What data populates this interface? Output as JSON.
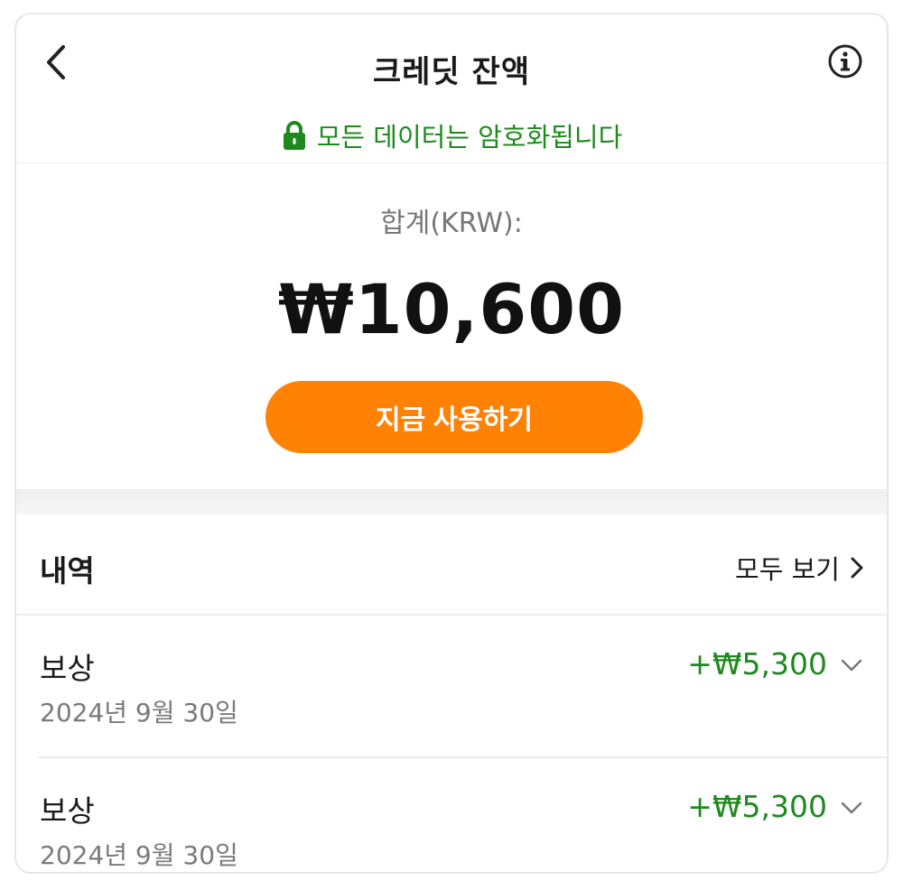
{
  "header": {
    "title": "크레딧 잔액",
    "back_icon": "chevron-left-icon",
    "info_icon": "info-icon"
  },
  "security": {
    "text": "모든 데이터는 암호화됩니다",
    "icon": "lock-icon",
    "color": "#1e8a1e"
  },
  "balance": {
    "label": "합계(KRW):",
    "amount": "₩10,600"
  },
  "action": {
    "use_now_label": "지금 사용하기",
    "color": "#ff8205"
  },
  "history": {
    "title": "내역",
    "view_all_label": "모두 보기",
    "items": [
      {
        "type": "보상",
        "date": "2024년 9월 30일",
        "amount": "+₩5,300"
      },
      {
        "type": "보상",
        "date": "2024년 9월 30일",
        "amount": "+₩5,300"
      }
    ]
  }
}
